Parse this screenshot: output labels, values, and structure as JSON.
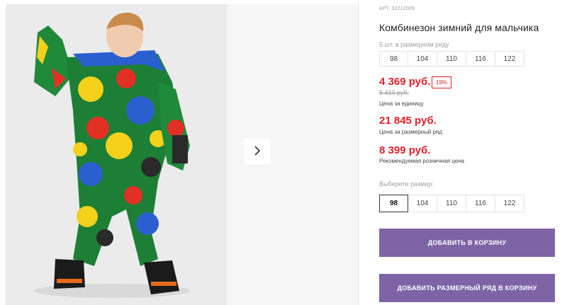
{
  "product": {
    "sku": "АРТ. 32212006",
    "title": "Комбинезон зимний для мальчика",
    "image_alt": "product-photo-boy-winter-jumpsuit"
  },
  "gallery": {
    "next_icon": "chevron-right-icon"
  },
  "pack": {
    "note": "5 шт. в размерном ряду",
    "sizes": [
      "98",
      "104",
      "110",
      "116",
      "122"
    ]
  },
  "prices": {
    "unit_price": "4 369 руб.",
    "discount": "19%",
    "old_price": "5 410 руб.",
    "unit_caption": "Цена за единицу",
    "pack_price": "21 845 руб.",
    "pack_caption": "Цена за размерный ряд",
    "retail_price": "8 399 руб.",
    "retail_caption": "Рекомендуемая розничная цена"
  },
  "size_picker": {
    "label": "Выберите размер:",
    "sizes": [
      "98",
      "104",
      "110",
      "116",
      "122"
    ],
    "selected": "98"
  },
  "actions": {
    "add_to_cart": "ДОБАВИТЬ В КОРЗИНУ",
    "add_pack_to_cart": "ДОБАВИТЬ РАЗМЕРНЫЙ РЯД В КОРЗИНУ"
  },
  "colors": {
    "price_red": "#e2202a",
    "button_purple": "#7e64a6"
  }
}
